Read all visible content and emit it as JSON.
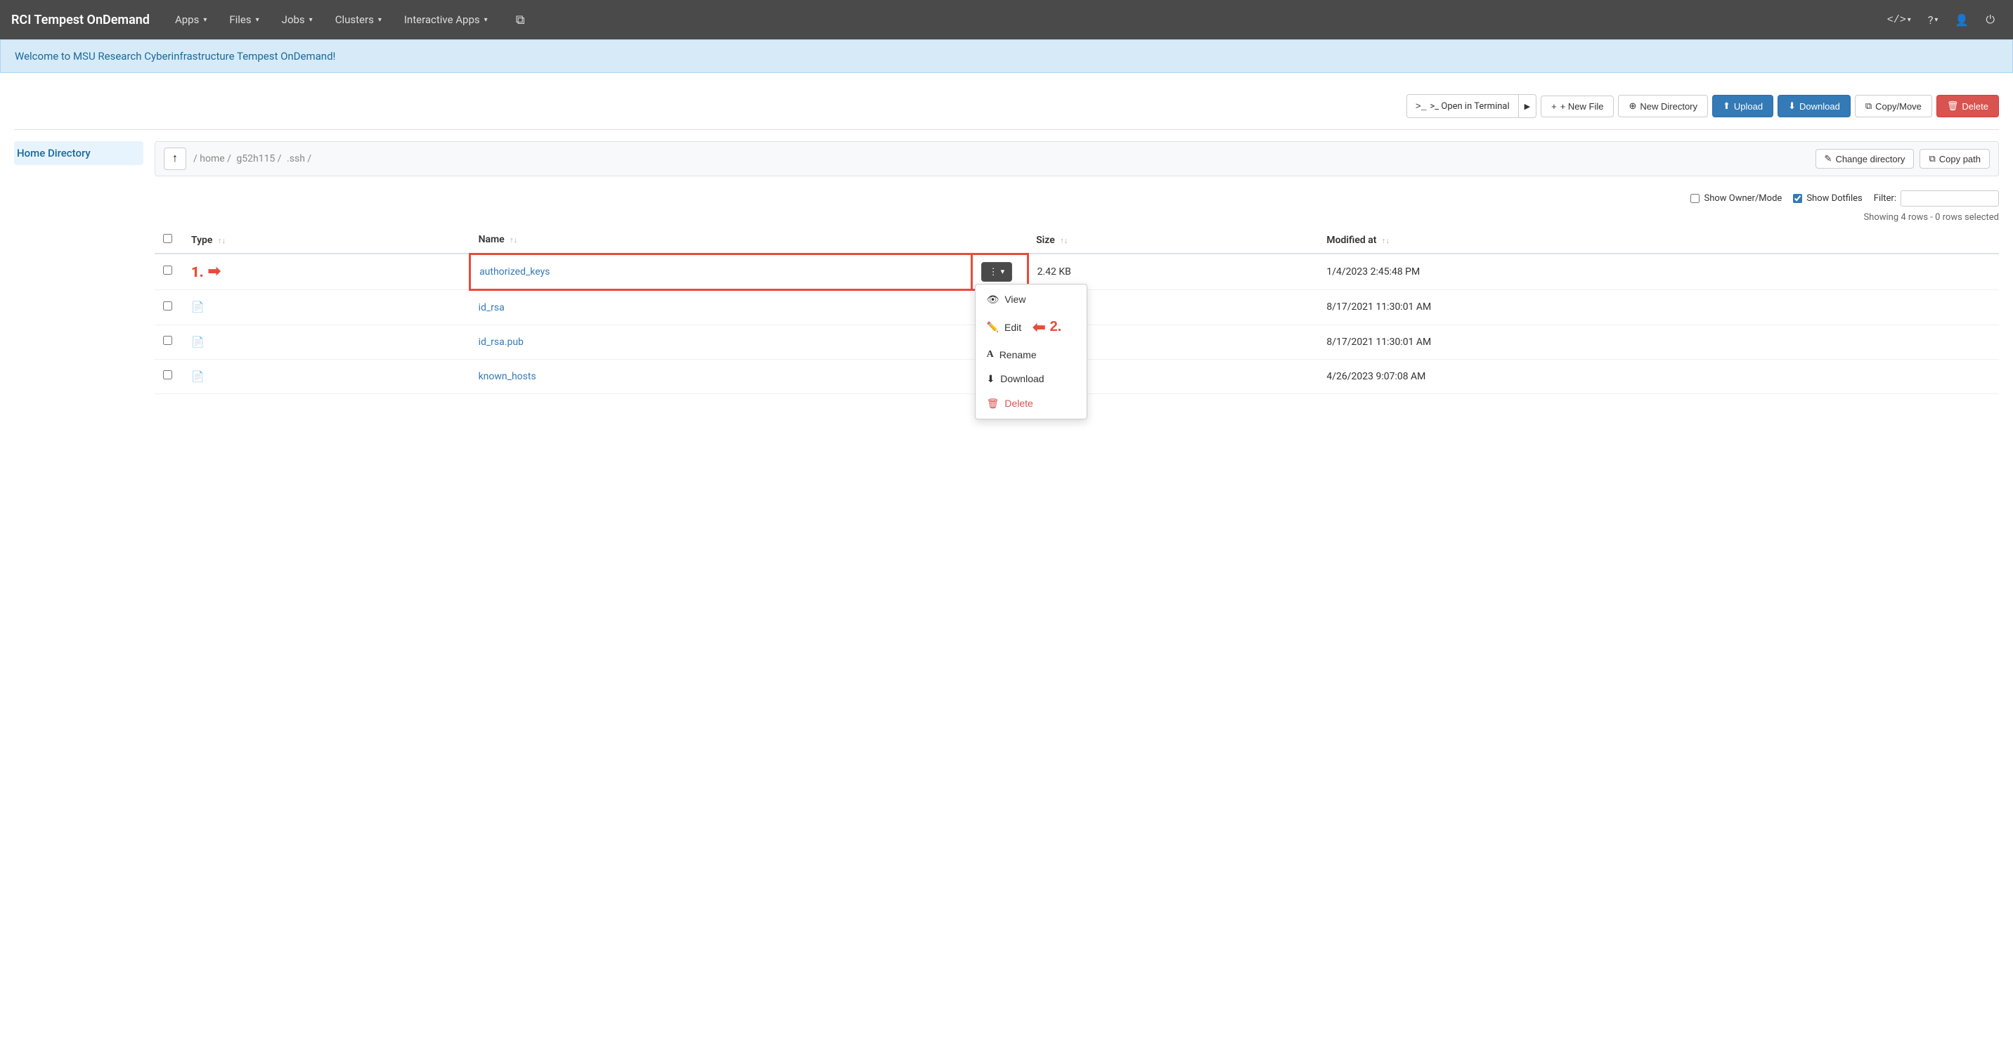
{
  "app": {
    "brand": "RCI Tempest OnDemand",
    "nav_items": [
      {
        "label": "Apps",
        "has_caret": true
      },
      {
        "label": "Files",
        "has_caret": true
      },
      {
        "label": "Jobs",
        "has_caret": true
      },
      {
        "label": "Clusters",
        "has_caret": true
      },
      {
        "label": "Interactive Apps",
        "has_caret": true
      }
    ],
    "navbar_icons": [
      {
        "name": "code-icon",
        "symbol": "</>"
      },
      {
        "name": "help-icon",
        "symbol": "?"
      },
      {
        "name": "user-icon",
        "symbol": "👤"
      },
      {
        "name": "power-icon",
        "symbol": "⏻"
      }
    ]
  },
  "welcome_banner": {
    "text": "Welcome to MSU Research Cyberinfrastructure Tempest OnDemand!"
  },
  "toolbar": {
    "terminal_label": ">_ Open in Terminal",
    "new_file_label": "+ New File",
    "new_directory_label": "New Directory",
    "upload_label": "Upload",
    "download_label": "Download",
    "copy_move_label": "Copy/Move",
    "delete_label": "Delete"
  },
  "sidebar": {
    "items": [
      {
        "label": "Home Directory",
        "active": true
      }
    ]
  },
  "path_bar": {
    "path_segments": [
      "/ home /",
      "g52h115 /",
      ".ssh /"
    ],
    "change_directory_label": "Change directory",
    "copy_path_label": "Copy path"
  },
  "options": {
    "show_owner_mode_label": "Show Owner/Mode",
    "show_owner_mode_checked": false,
    "show_dotfiles_label": "Show Dotfiles",
    "show_dotfiles_checked": true,
    "filter_label": "Filter:",
    "filter_placeholder": "",
    "row_count_text": "Showing 4 rows - 0 rows selected"
  },
  "table": {
    "headers": [
      {
        "label": "",
        "key": "checkbox"
      },
      {
        "label": "Type",
        "key": "type"
      },
      {
        "label": "Name",
        "key": "name"
      },
      {
        "label": "",
        "key": "actions"
      },
      {
        "label": "Size",
        "key": "size"
      },
      {
        "label": "Modified at",
        "key": "modified"
      }
    ],
    "rows": [
      {
        "id": 1,
        "type_icon": "📄",
        "name": "authorized_keys",
        "size": "2.42 KB",
        "modified": "1/4/2023 2:45:48 PM",
        "highlighted": true,
        "show_dropdown": true
      },
      {
        "id": 2,
        "type_icon": "📄",
        "name": "id_rsa",
        "size": "",
        "modified": "8/17/2021 11:30:01 AM",
        "highlighted": false,
        "show_dropdown": false
      },
      {
        "id": 3,
        "type_icon": "📄",
        "name": "id_rsa.pub",
        "size": "",
        "modified": "8/17/2021 11:30:01 AM",
        "highlighted": false,
        "show_dropdown": false
      },
      {
        "id": 4,
        "type_icon": "📄",
        "name": "known_hosts",
        "size": "",
        "modified": "4/26/2023 9:07:08 AM",
        "highlighted": false,
        "show_dropdown": false
      }
    ]
  },
  "dropdown_menu": {
    "items": [
      {
        "label": "View",
        "icon": "👁",
        "danger": false
      },
      {
        "label": "Edit",
        "icon": "✏️",
        "danger": false
      },
      {
        "label": "Rename",
        "icon": "A",
        "danger": false
      },
      {
        "label": "Download",
        "icon": "⬇",
        "danger": false
      },
      {
        "label": "Delete",
        "icon": "🗑",
        "danger": true
      }
    ]
  },
  "annotations": {
    "step1_label": "1.",
    "step2_label": "2."
  },
  "icons": {
    "upload_icon": "⬆",
    "download_icon": "⬇",
    "copy_icon": "⧉",
    "delete_icon": "🗑",
    "new_file_icon": "+",
    "new_dir_icon": "⊕",
    "terminal_icon": ">_",
    "change_dir_icon": "✎",
    "copy_path_icon": "⧉",
    "up_arrow": "↑",
    "sort_asc": "↑",
    "sort_desc": "↓",
    "dots_icon": "⋮"
  }
}
